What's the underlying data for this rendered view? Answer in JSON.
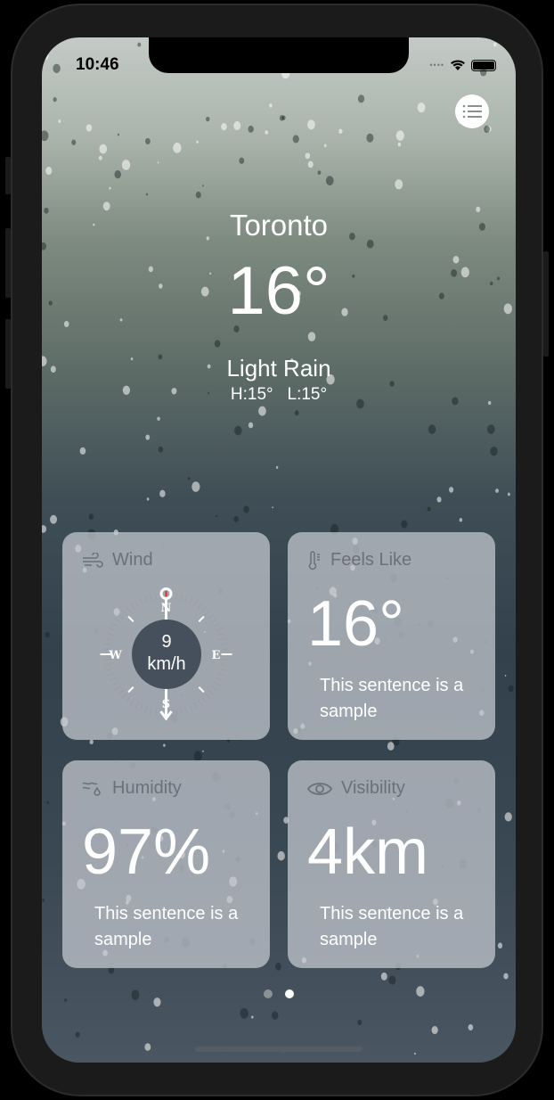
{
  "status_bar": {
    "time": "10:46"
  },
  "location": {
    "city": "Toronto",
    "temperature": "16°",
    "condition": "Light Rain",
    "high": "H:15°",
    "low": "L:15°"
  },
  "cards": {
    "wind": {
      "title": "Wind",
      "speed": "9",
      "unit": "km/h",
      "directions": {
        "n": "N",
        "e": "E",
        "s": "S",
        "w": "W"
      },
      "icon": "wind-icon"
    },
    "feels_like": {
      "title": "Feels Like",
      "value": "16°",
      "description": "This sentence is a sample",
      "icon": "thermometer-icon"
    },
    "humidity": {
      "title": "Humidity",
      "value": "97%",
      "description": "This sentence is a sample",
      "icon": "humidity-icon"
    },
    "visibility": {
      "title": "Visibility",
      "value": "4km",
      "description": "This sentence is a sample",
      "icon": "eye-icon"
    }
  },
  "pagination": {
    "pages": 2,
    "current": 2
  },
  "colors": {
    "compass_center": "#46505c",
    "north_marker": "#e0302a"
  }
}
